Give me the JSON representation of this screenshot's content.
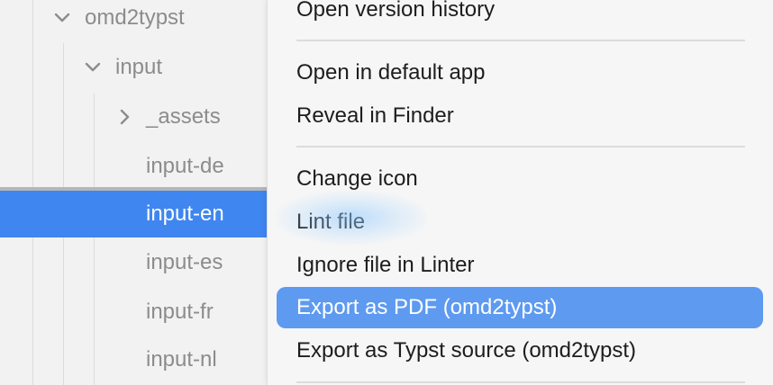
{
  "tree": {
    "items": [
      {
        "label": "omd2typst",
        "expanded": true
      },
      {
        "label": "input",
        "expanded": true
      },
      {
        "label": "_assets",
        "expanded": false
      },
      {
        "label": "input-de"
      },
      {
        "label": "input-en",
        "selected": true
      },
      {
        "label": "input-es"
      },
      {
        "label": "input-fr"
      },
      {
        "label": "input-nl"
      }
    ]
  },
  "menu": {
    "items": [
      {
        "label": "Open version history"
      },
      {
        "label": "Open in default app"
      },
      {
        "label": "Reveal in Finder"
      },
      {
        "label": "Change icon"
      },
      {
        "label": "Lint file"
      },
      {
        "label": "Ignore file in Linter"
      },
      {
        "label": "Export as PDF (omd2typst)",
        "active": true
      },
      {
        "label": "Export as Typst source (omd2typst)"
      }
    ]
  },
  "colors": {
    "selection": "#3f86f0",
    "menu_highlight": "#5d9af0",
    "tree_text": "#8c8c8c",
    "menu_text": "#1d1d1d"
  }
}
